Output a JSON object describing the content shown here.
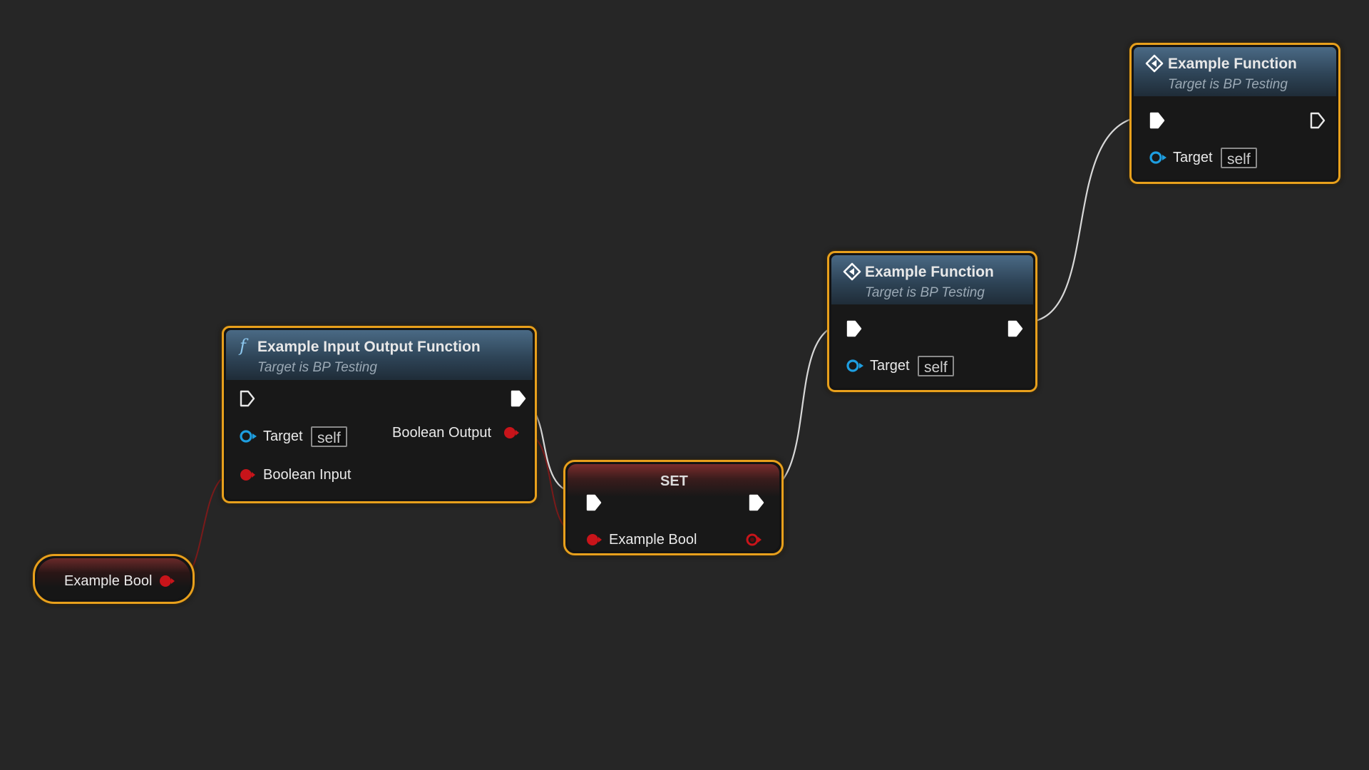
{
  "graph": {
    "background_color": "#262626",
    "wire_color_exec": "#d8d8d8",
    "wire_color_bool": "#8c1c1c",
    "selection_color": "#e8a01c"
  },
  "nodes": {
    "example_bool_getter": {
      "label": "Example Bool",
      "pin_color": "#c8141a"
    },
    "input_output_function": {
      "icon": "function-icon",
      "icon_glyph": "f",
      "title": "Example Input Output Function",
      "subtitle": "Target is BP Testing",
      "target_label": "Target",
      "target_value": "self",
      "boolean_input_label": "Boolean Input",
      "boolean_output_label": "Boolean Output"
    },
    "set_node": {
      "title": "SET",
      "variable_label": "Example Bool"
    },
    "example_function_1": {
      "icon": "event-function-icon",
      "title": "Example Function",
      "subtitle": "Target is BP Testing",
      "target_label": "Target",
      "target_value": "self"
    },
    "example_function_2": {
      "icon": "event-function-icon",
      "title": "Example Function",
      "subtitle": "Target is BP Testing",
      "target_label": "Target",
      "target_value": "self"
    }
  }
}
